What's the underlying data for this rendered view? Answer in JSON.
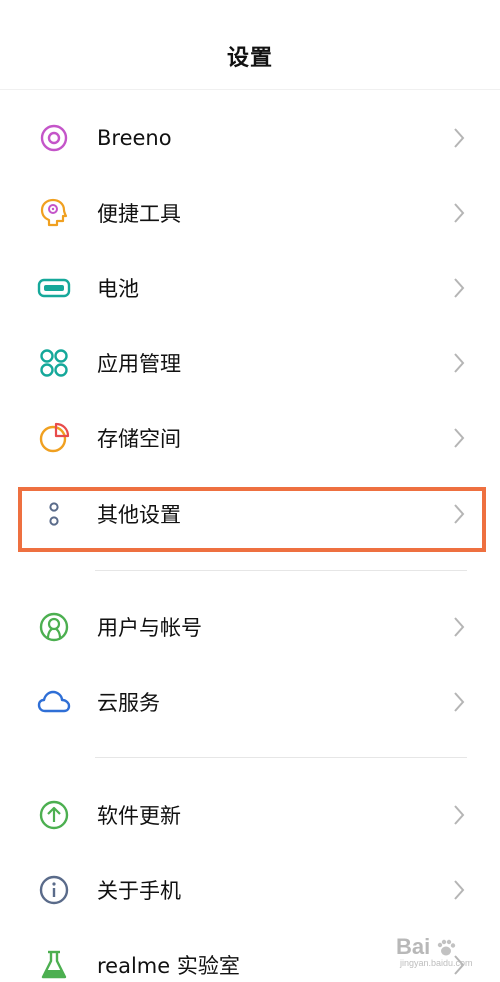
{
  "header": {
    "title": "设置"
  },
  "items": [
    {
      "label": "Breeno",
      "icon": "breeno-icon",
      "color": "#c455c9"
    },
    {
      "label": "便捷工具",
      "icon": "head-tool-icon",
      "color": "#f0a020"
    },
    {
      "label": "电池",
      "icon": "battery-icon",
      "color": "#15a89a"
    },
    {
      "label": "应用管理",
      "icon": "app-grid-icon",
      "color": "#15a89a"
    },
    {
      "label": "存储空间",
      "icon": "storage-pie-icon",
      "color": "#f0a020"
    },
    {
      "label": "其他设置",
      "icon": "more-dots-icon",
      "color": "#5a6b8a"
    },
    {
      "label": "用户与帐号",
      "icon": "user-icon",
      "color": "#4caf50"
    },
    {
      "label": "云服务",
      "icon": "cloud-icon",
      "color": "#2f6fd6"
    },
    {
      "label": "软件更新",
      "icon": "update-arrow-icon",
      "color": "#4caf50"
    },
    {
      "label": "关于手机",
      "icon": "info-icon",
      "color": "#5a6b8a"
    },
    {
      "label": "realme 实验室",
      "icon": "flask-icon",
      "color": "#4caf50"
    }
  ],
  "highlight_color": "#ee7040",
  "watermark": {
    "logo": "Bai",
    "sub": "jingyan.baidu.com"
  }
}
